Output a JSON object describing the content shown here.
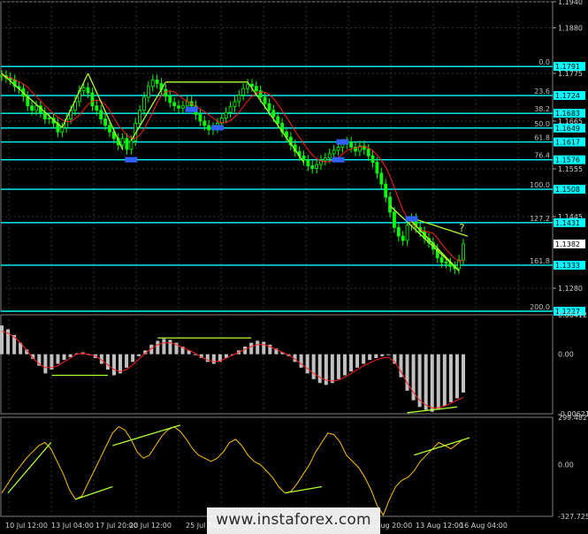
{
  "colors": {
    "background": "#000000",
    "grid": "#2a3a2a",
    "price": "#00ff00",
    "level": "#00ffff",
    "trend": "#adff2f",
    "signal": "#ff2020",
    "histogram": "#c0c0c0",
    "oscillator": "#ffc000",
    "marker": "#3060ff"
  },
  "watermark": "www.instaforex.com",
  "chart_data": [
    {
      "type": "line",
      "panel": "price",
      "ylim": [
        1.1227,
        1.194
      ],
      "y_tick_labels": [
        "1.1940",
        "1.1880",
        "1.1775",
        "1.1665",
        "1.1555",
        "1.1445",
        "1.1280"
      ],
      "x_tick_labels": [
        "10 Jul 12:00",
        "13 Jul 04:00",
        "17 Jul 20:00",
        "20 Jul 12:00",
        "25 Jul 04:00",
        "Aug 20:00",
        "13 Aug 12:00",
        "16 Aug 04:00"
      ],
      "levels": [
        {
          "price": 1.1791,
          "label": "1.1791",
          "fib": "0.0"
        },
        {
          "price": 1.1724,
          "label": "1.1724",
          "fib": "23.6"
        },
        {
          "price": 1.1683,
          "label": "1.1683",
          "fib": "38.2"
        },
        {
          "price": 1.1649,
          "label": "1.1649",
          "fib": "50.0"
        },
        {
          "price": 1.1617,
          "label": "1.1617",
          "fib": "61.8"
        },
        {
          "price": 1.1576,
          "label": "1.1576",
          "fib": "76.4"
        },
        {
          "price": 1.1508,
          "label": "1.1508",
          "fib": "100.0"
        },
        {
          "price": 1.1431,
          "label": "1.1431",
          "fib": "127.2"
        },
        {
          "price": 1.1333,
          "label": "1.1333",
          "fib": "161.8"
        },
        {
          "price": 1.1227,
          "label": "1.1227",
          "fib": "200.0"
        }
      ],
      "current_price": {
        "price": 1.1382,
        "label": "1.1382"
      },
      "annotation": "?",
      "series": [
        {
          "values": [
            1.177,
            1.1765,
            1.176,
            1.1745,
            1.174,
            1.1722,
            1.17,
            1.169,
            1.17,
            1.1685,
            1.167,
            1.1672,
            1.166,
            1.164,
            1.165,
            1.167,
            1.169,
            1.171,
            1.1735,
            1.1742,
            1.173,
            1.17,
            1.169,
            1.167,
            1.1655,
            1.164,
            1.1625,
            1.161,
            1.1625,
            1.16,
            1.162,
            1.166,
            1.169,
            1.172,
            1.1745,
            1.176,
            1.1752,
            1.1738,
            1.1722,
            1.1708,
            1.17,
            1.1695,
            1.17,
            1.171,
            1.17,
            1.168,
            1.1665,
            1.1655,
            1.1645,
            1.165,
            1.166,
            1.1672,
            1.1685,
            1.1698,
            1.171,
            1.1725,
            1.174,
            1.175,
            1.1745,
            1.1735,
            1.172,
            1.1705,
            1.169,
            1.1675,
            1.166,
            1.164,
            1.1628,
            1.161,
            1.1595,
            1.1585,
            1.1575,
            1.1562,
            1.1556,
            1.1565,
            1.1575,
            1.158,
            1.159,
            1.1598,
            1.1605,
            1.1612,
            1.1617,
            1.1605,
            1.1596,
            1.1608,
            1.16,
            1.1585,
            1.157,
            1.1545,
            1.152,
            1.149,
            1.1455,
            1.142,
            1.14,
            1.139,
            1.1425,
            1.144,
            1.142,
            1.141,
            1.1395,
            1.1385,
            1.137,
            1.135,
            1.134,
            1.1338,
            1.133,
            1.1325,
            1.1345,
            1.1382
          ]
        }
      ]
    },
    {
      "type": "bar",
      "panel": "macd",
      "ylim": [
        -0.00621,
        0.00412
      ],
      "y_tick_labels": [
        "0.00412",
        "0.00",
        "-0.00621"
      ],
      "values": [
        0.003,
        0.0026,
        0.002,
        0.0012,
        0.0005,
        -0.0005,
        -0.0012,
        -0.002,
        -0.0016,
        -0.001,
        -0.0006,
        -0.0003,
        0.0001,
        0.0002,
        0.0,
        -0.0004,
        -0.001,
        -0.0016,
        -0.0022,
        -0.002,
        -0.0014,
        -0.0008,
        -0.0002,
        0.0004,
        0.001,
        0.0014,
        0.0016,
        0.0015,
        0.0012,
        0.0008,
        0.0004,
        0.0,
        -0.0004,
        -0.0008,
        -0.001,
        -0.0008,
        -0.0004,
        0.0,
        0.0004,
        0.0008,
        0.0012,
        0.0014,
        0.0013,
        0.001,
        0.0006,
        0.0002,
        -0.0002,
        -0.0008,
        -0.0014,
        -0.002,
        -0.0026,
        -0.003,
        -0.0032,
        -0.003,
        -0.0026,
        -0.0022,
        -0.0018,
        -0.0014,
        -0.001,
        -0.0006,
        -0.0004,
        -0.0002,
        0.0,
        -0.001,
        -0.0024,
        -0.0038,
        -0.0048,
        -0.0055,
        -0.0058,
        -0.006,
        -0.0058,
        -0.0054,
        -0.005,
        -0.0046,
        -0.004
      ],
      "signal": [
        0.0024,
        0.0022,
        0.0018,
        0.0012,
        0.0004,
        -0.0004,
        -0.001,
        -0.0014,
        -0.0014,
        -0.0012,
        -0.0008,
        -0.0004,
        0.0,
        0.0001,
        0.0,
        -0.0002,
        -0.0006,
        -0.0011,
        -0.0016,
        -0.0018,
        -0.0016,
        -0.0011,
        -0.0005,
        0.0001,
        0.0006,
        0.001,
        0.0012,
        0.0012,
        0.001,
        0.0007,
        0.0004,
        0.0001,
        -0.0003,
        -0.0006,
        -0.0008,
        -0.0007,
        -0.0004,
        -0.0001,
        0.0002,
        0.0005,
        0.0008,
        0.001,
        0.001,
        0.0008,
        0.0005,
        0.0002,
        -0.0001,
        -0.0005,
        -0.001,
        -0.0015,
        -0.002,
        -0.0024,
        -0.0027,
        -0.0028,
        -0.0027,
        -0.0024,
        -0.002,
        -0.0016,
        -0.0012,
        -0.0009,
        -0.0006,
        -0.0004,
        -0.0003,
        -0.0008,
        -0.0018,
        -0.003,
        -0.004,
        -0.0048,
        -0.0053,
        -0.0056,
        -0.0056,
        -0.0054,
        -0.0051,
        -0.0048,
        -0.0045
      ]
    },
    {
      "type": "line",
      "panel": "cci",
      "ylim": [
        -327.725,
        299.482
      ],
      "y_tick_labels": [
        "299.482",
        "0.00",
        "-327.725"
      ],
      "values": [
        -180,
        -120,
        -60,
        -10,
        40,
        80,
        120,
        140,
        100,
        20,
        -60,
        -160,
        -220,
        -200,
        -120,
        -40,
        40,
        120,
        200,
        240,
        220,
        160,
        80,
        40,
        60,
        120,
        180,
        220,
        240,
        210,
        160,
        100,
        60,
        40,
        20,
        40,
        80,
        140,
        160,
        120,
        60,
        20,
        0,
        -40,
        -80,
        -140,
        -180,
        -170,
        -120,
        -60,
        0,
        80,
        140,
        200,
        190,
        140,
        60,
        20,
        -20,
        -80,
        -160,
        -260,
        -320,
        -220,
        -140,
        -100,
        -80,
        -40,
        20,
        60,
        100,
        140,
        120,
        100,
        130,
        160
      ]
    }
  ]
}
